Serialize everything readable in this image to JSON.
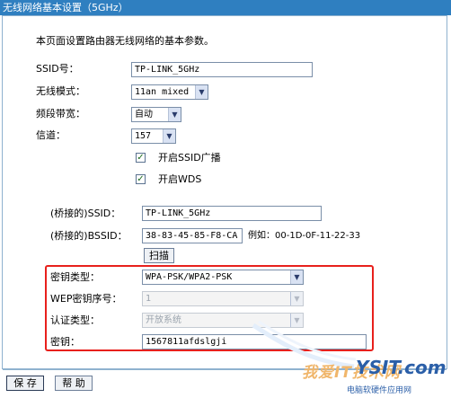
{
  "window": {
    "title": "无线网络基本设置（5GHz）"
  },
  "intro": "本页面设置路由器无线网络的基本参数。",
  "fields": {
    "ssid": {
      "label": "SSID号：",
      "value": "TP-LINK_5GHz"
    },
    "mode": {
      "label": "无线模式：",
      "value": "11an mixed"
    },
    "bandwidth": {
      "label": "频段带宽：",
      "value": "自动"
    },
    "channel": {
      "label": "信道：",
      "value": "157"
    }
  },
  "checkboxes": {
    "ssid_broadcast": {
      "label": "开启SSID广播",
      "checked": true
    },
    "wds": {
      "label": "开启WDS",
      "checked": true
    }
  },
  "bridge": {
    "ssid": {
      "label": "(桥接的)SSID：",
      "value": "TP-LINK_5GHz"
    },
    "bssid": {
      "label": "(桥接的)BSSID：",
      "value": "38-83-45-85-F8-CA",
      "example": "例如：00-1D-0F-11-22-33"
    },
    "scan_label": "扫描"
  },
  "security": {
    "key_type": {
      "label": "密钥类型：",
      "value": "WPA-PSK/WPA2-PSK"
    },
    "wep_index": {
      "label": "WEP密钥序号：",
      "value": "1"
    },
    "auth_type": {
      "label": "认证类型：",
      "value": "开放系统"
    },
    "key": {
      "label": "密钥：",
      "value": "1567811afdslgji"
    }
  },
  "footer": {
    "save_label": "保 存",
    "help_label": "帮 助"
  },
  "watermark": {
    "main": "我爱IT技术网",
    "site": "YSIT.com",
    "sub": "电脑软硬件应用网"
  },
  "colors": {
    "titlebar": "#2f7fc0",
    "highlight": "#e8201c"
  },
  "icons": {
    "dropdown": "chevron-down-icon",
    "check": "checkmark-icon"
  }
}
